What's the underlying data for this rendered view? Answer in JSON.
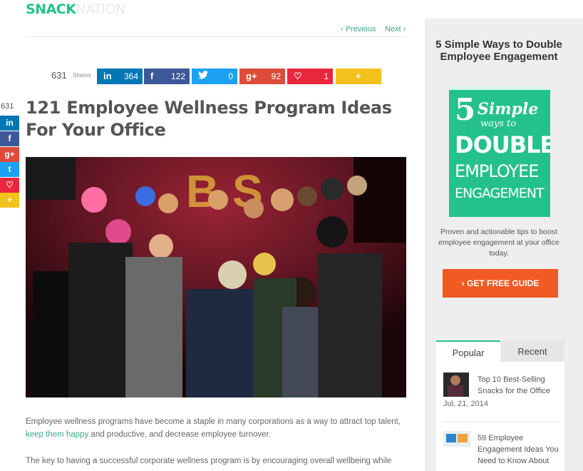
{
  "header": {
    "logo_part1": "SNACK",
    "logo_part2": "NATION"
  },
  "post_nav": {
    "previous": "‹ Previous",
    "next": "Next ›"
  },
  "share": {
    "total": "631",
    "label": "Shares",
    "buttons": [
      {
        "icon": "in",
        "count": "364",
        "color": "#0077b5"
      },
      {
        "icon": "f",
        "count": "122",
        "color": "#3b5998"
      },
      {
        "icon": "🐦",
        "count": "0",
        "color": "#1da1f2"
      },
      {
        "icon": "g+",
        "count": "92",
        "color": "#dd4b39"
      },
      {
        "icon": "♡",
        "count": "1",
        "color": "#e8273c"
      },
      {
        "icon": "+",
        "count": "",
        "color": "#f3c11b"
      }
    ]
  },
  "side_share": {
    "count": "631",
    "buttons": [
      {
        "icon": "in",
        "color": "#0077b5"
      },
      {
        "icon": "f",
        "color": "#3b5998"
      },
      {
        "icon": "g+",
        "color": "#dd4b39"
      },
      {
        "icon": "t",
        "color": "#1da1f2"
      },
      {
        "icon": "♡",
        "color": "#e8273c"
      },
      {
        "icon": "+",
        "color": "#f3c11b"
      }
    ]
  },
  "article": {
    "title": "121 Employee Wellness Program Ideas For Your Office",
    "para1_a": "Employee wellness programs have become a staple in many corporations as a way to attract top talent, ",
    "para1_link": "keep them happy",
    "para1_b": " and productive, and decrease employee turnover.",
    "para2": "The key to having a successful corporate wellness program is by encouraging overall wellbeing while"
  },
  "sidebar": {
    "title": "5 Simple Ways to Double Employee Engagement",
    "book": {
      "line1": "5",
      "line1b": "Simple",
      "line2": "ways to",
      "line3": "DOUBLE",
      "line4": "EMPLOYEE",
      "line5": "ENGAGEMENT"
    },
    "desc": "Proven and actionable tips to boost employee engagement at your office today.",
    "cta": "› GET FREE GUIDE",
    "tabs": [
      {
        "label": "Popular"
      },
      {
        "label": "Recent"
      }
    ],
    "posts": [
      {
        "title": "Top 10 Best-Selling Snacks for the Office",
        "date": "Jul, 21, 2014"
      },
      {
        "title": "59 Employee Engagement Ideas You Need to Know About",
        "date": ""
      }
    ]
  },
  "colors": {
    "brand": "#22c389",
    "link": "#3aa98a",
    "cta": "#f15a22"
  }
}
